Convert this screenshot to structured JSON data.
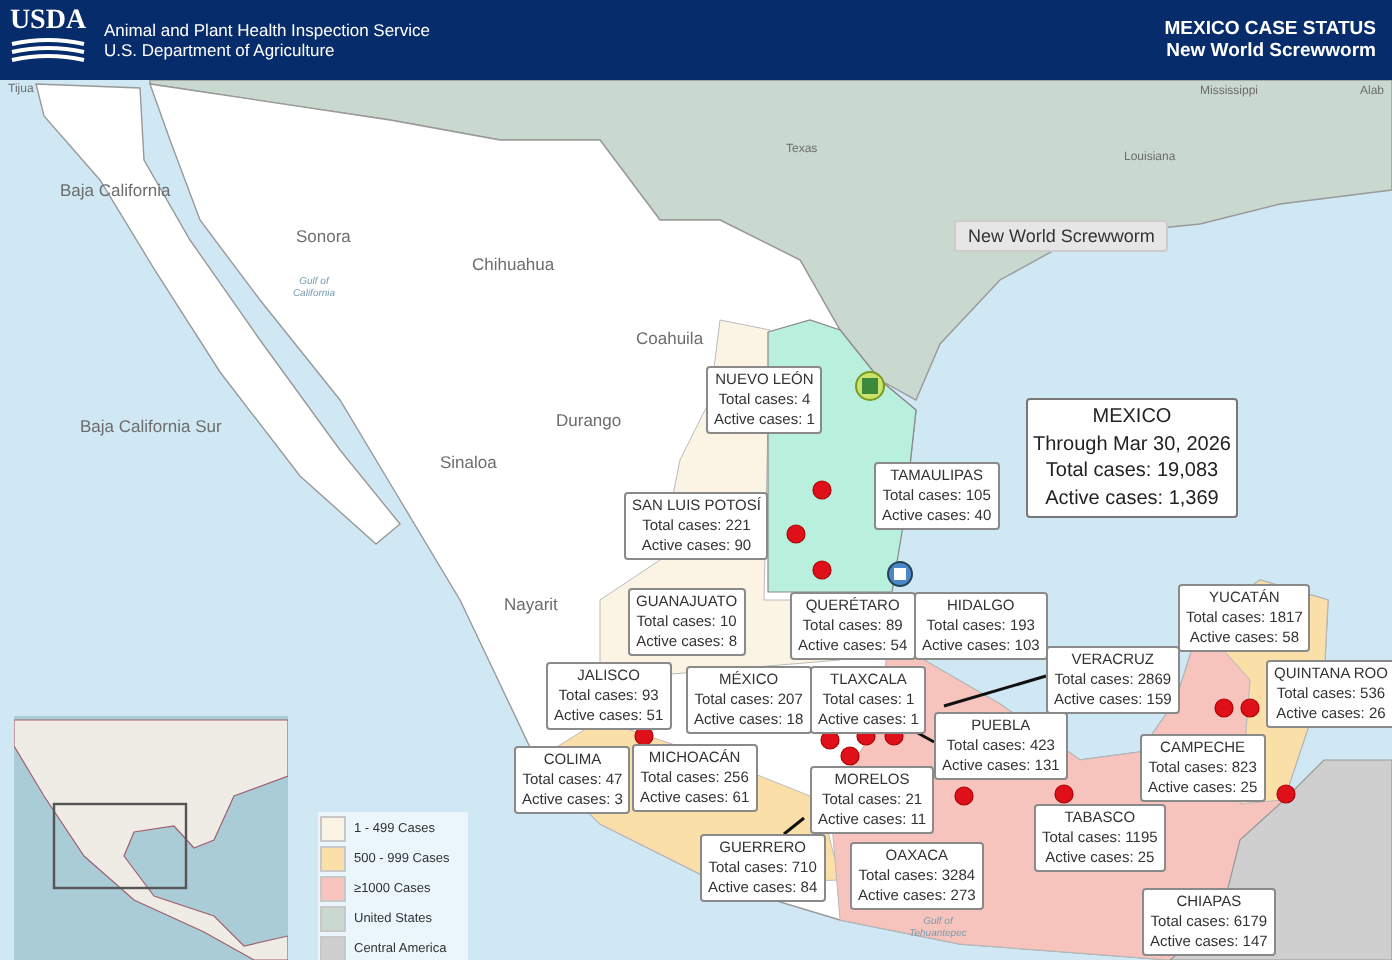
{
  "header": {
    "logo": "USDA",
    "agency": "Animal and Plant Health Inspection Service",
    "department": "U.S. Department of Agriculture",
    "title": "MEXICO CASE STATUS",
    "subtitle": "New World Screwworm"
  },
  "map": {
    "place_labels": [
      {
        "text": "Tijua"
      },
      {
        "text": "Mississippi"
      },
      {
        "text": "Alab"
      },
      {
        "text": "Texas"
      },
      {
        "text": "Louisiana"
      },
      {
        "text": "Baja California"
      },
      {
        "text": "Sonora"
      },
      {
        "text": "Chihuahua"
      },
      {
        "text": "Gulf of California"
      },
      {
        "text": "Coahuila"
      },
      {
        "text": "Baja California Sur"
      },
      {
        "text": "Durango"
      },
      {
        "text": "Sinaloa"
      },
      {
        "text": "Nayarit"
      },
      {
        "text": "Gulf of Tehuantepec"
      }
    ],
    "tooltip": "New World Screwworm",
    "summary": {
      "country": "MEXICO",
      "date": "Through Mar 30, 2026",
      "total": "Total cases: 19,083",
      "active": "Active cases: 1,369"
    },
    "states": [
      {
        "name": "NUEVO LEÓN",
        "total": "Total cases: 4",
        "active": "Active cases: 1"
      },
      {
        "name": "TAMAULIPAS",
        "total": "Total cases: 105",
        "active": "Active cases: 40"
      },
      {
        "name": "SAN LUIS POTOSÍ",
        "total": "Total cases: 221",
        "active": "Active cases: 90"
      },
      {
        "name": "GUANAJUATO",
        "total": "Total cases: 10",
        "active": "Active cases: 8"
      },
      {
        "name": "QUERÉTARO",
        "total": "Total cases: 89",
        "active": "Active cases: 54"
      },
      {
        "name": "HIDALGO",
        "total": "Total cases: 193",
        "active": "Active cases: 103"
      },
      {
        "name": "YUCATÁN",
        "total": "Total cases: 1817",
        "active": "Active cases: 58"
      },
      {
        "name": "JALISCO",
        "total": "Total cases: 93",
        "active": "Active cases: 51"
      },
      {
        "name": "MÉXICO",
        "total": "Total cases: 207",
        "active": "Active cases: 18"
      },
      {
        "name": "TLAXCALA",
        "total": "Total cases: 1",
        "active": "Active cases: 1"
      },
      {
        "name": "VERACRUZ",
        "total": "Total cases: 2869",
        "active": "Active cases: 159"
      },
      {
        "name": "QUINTANA ROO",
        "total": "Total cases: 536",
        "active": "Active cases: 26"
      },
      {
        "name": "PUEBLA",
        "total": "Total cases: 423",
        "active": "Active cases: 131"
      },
      {
        "name": "CAMPECHE",
        "total": "Total cases: 823",
        "active": "Active cases: 25"
      },
      {
        "name": "COLIMA",
        "total": "Total cases: 47",
        "active": "Active cases: 3"
      },
      {
        "name": "MICHOACÁN",
        "total": "Total cases: 256",
        "active": "Active cases: 61"
      },
      {
        "name": "MORELOS",
        "total": "Total cases: 21",
        "active": "Active cases: 11"
      },
      {
        "name": "TABASCO",
        "total": "Total cases: 1195",
        "active": "Active cases: 25"
      },
      {
        "name": "GUERRERO",
        "total": "Total cases: 710",
        "active": "Active cases: 84"
      },
      {
        "name": "OAXACA",
        "total": "Total cases: 3284",
        "active": "Active cases: 273"
      },
      {
        "name": "CHIAPAS",
        "total": "Total cases: 6179",
        "active": "Active cases: 147"
      }
    ],
    "legend": [
      {
        "label": "1 - 499 Cases",
        "color": "#fbf3e4"
      },
      {
        "label": "500 - 999 Cases",
        "color": "#fbdfa8"
      },
      {
        "label": "≥1000 Cases",
        "color": "#f7c4bd"
      },
      {
        "label": "United States",
        "color": "#c9d9cf"
      },
      {
        "label": "Central America",
        "color": "#cfcfcf"
      }
    ]
  }
}
